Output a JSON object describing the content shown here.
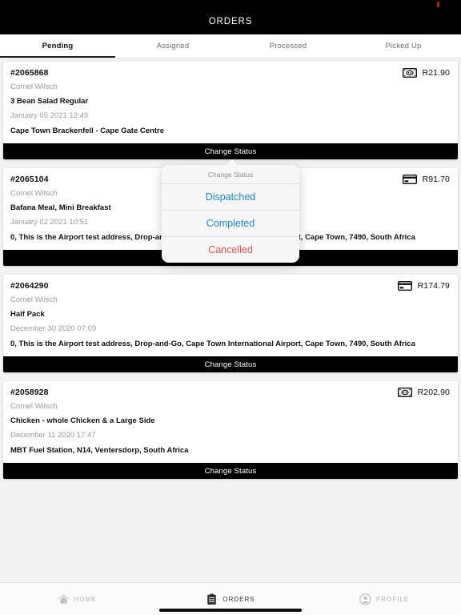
{
  "statusbar": {
    "recording_indicator": "recording-dot"
  },
  "header": {
    "title": "ORDERS"
  },
  "tabs": [
    {
      "label": "Pending",
      "active": true
    },
    {
      "label": "Assigned",
      "active": false
    },
    {
      "label": "Processed",
      "active": false
    },
    {
      "label": "Picked Up",
      "active": false
    }
  ],
  "orders": [
    {
      "id": "#2065868",
      "customer": "Cornel Wilsch",
      "items": "3 Bean Salad Regular",
      "date": "January 05 2021 12:49",
      "address": "Cape Town Brackenfell - Cape Gate Centre",
      "price": "R21.90",
      "payment_icon": "cash-icon",
      "action_label": "Change Status"
    },
    {
      "id": "#2065104",
      "customer": "Cornel Wilsch",
      "items": "Bafana Meal, Mini Breakfast",
      "date": "January 02 2021 10:51",
      "address": "0, This is the Airport test address, Drop-and-Go, Cape Town International Airport, Cape Town, 7490, South Africa",
      "price": "R91.70",
      "payment_icon": "credit-card-icon",
      "action_label": "Change Status"
    },
    {
      "id": "#2064290",
      "customer": "Cornel Wilsch",
      "items": "Half Pack",
      "date": "December 30 2020 07:09",
      "address": "0, This is the Airport test address, Drop-and-Go, Cape Town International Airport, Cape Town, 7490, South Africa",
      "price": "R174.79",
      "payment_icon": "credit-card-icon",
      "action_label": "Change Status"
    },
    {
      "id": "#2058928",
      "customer": "Cornel Wilsch",
      "items": "Chicken - whole Chicken & a Large Side",
      "date": "December 11 2020 17:47",
      "address": "MBT Fuel Station, N14, Ventersdorp, South Africa",
      "price": "R202.90",
      "payment_icon": "cash-icon",
      "action_label": "Change Status"
    }
  ],
  "popover": {
    "title": "Change Status",
    "options": [
      {
        "label": "Dispatched",
        "color": "#1a86f0"
      },
      {
        "label": "Completed",
        "color": "#1a86f0"
      },
      {
        "label": "Cancelled",
        "color": "#ff4f45"
      }
    ]
  },
  "bottom_nav": [
    {
      "label": "HOME",
      "icon": "home-icon",
      "active": false
    },
    {
      "label": "ORDERS",
      "icon": "clipboard-icon",
      "active": true
    },
    {
      "label": "PROFILE",
      "icon": "person-icon",
      "active": false
    }
  ],
  "colors": {
    "accent_blue": "#1a86f0",
    "danger_red": "#ff4f45",
    "bar_black": "#000000",
    "page_bg": "#f2f2f2"
  }
}
